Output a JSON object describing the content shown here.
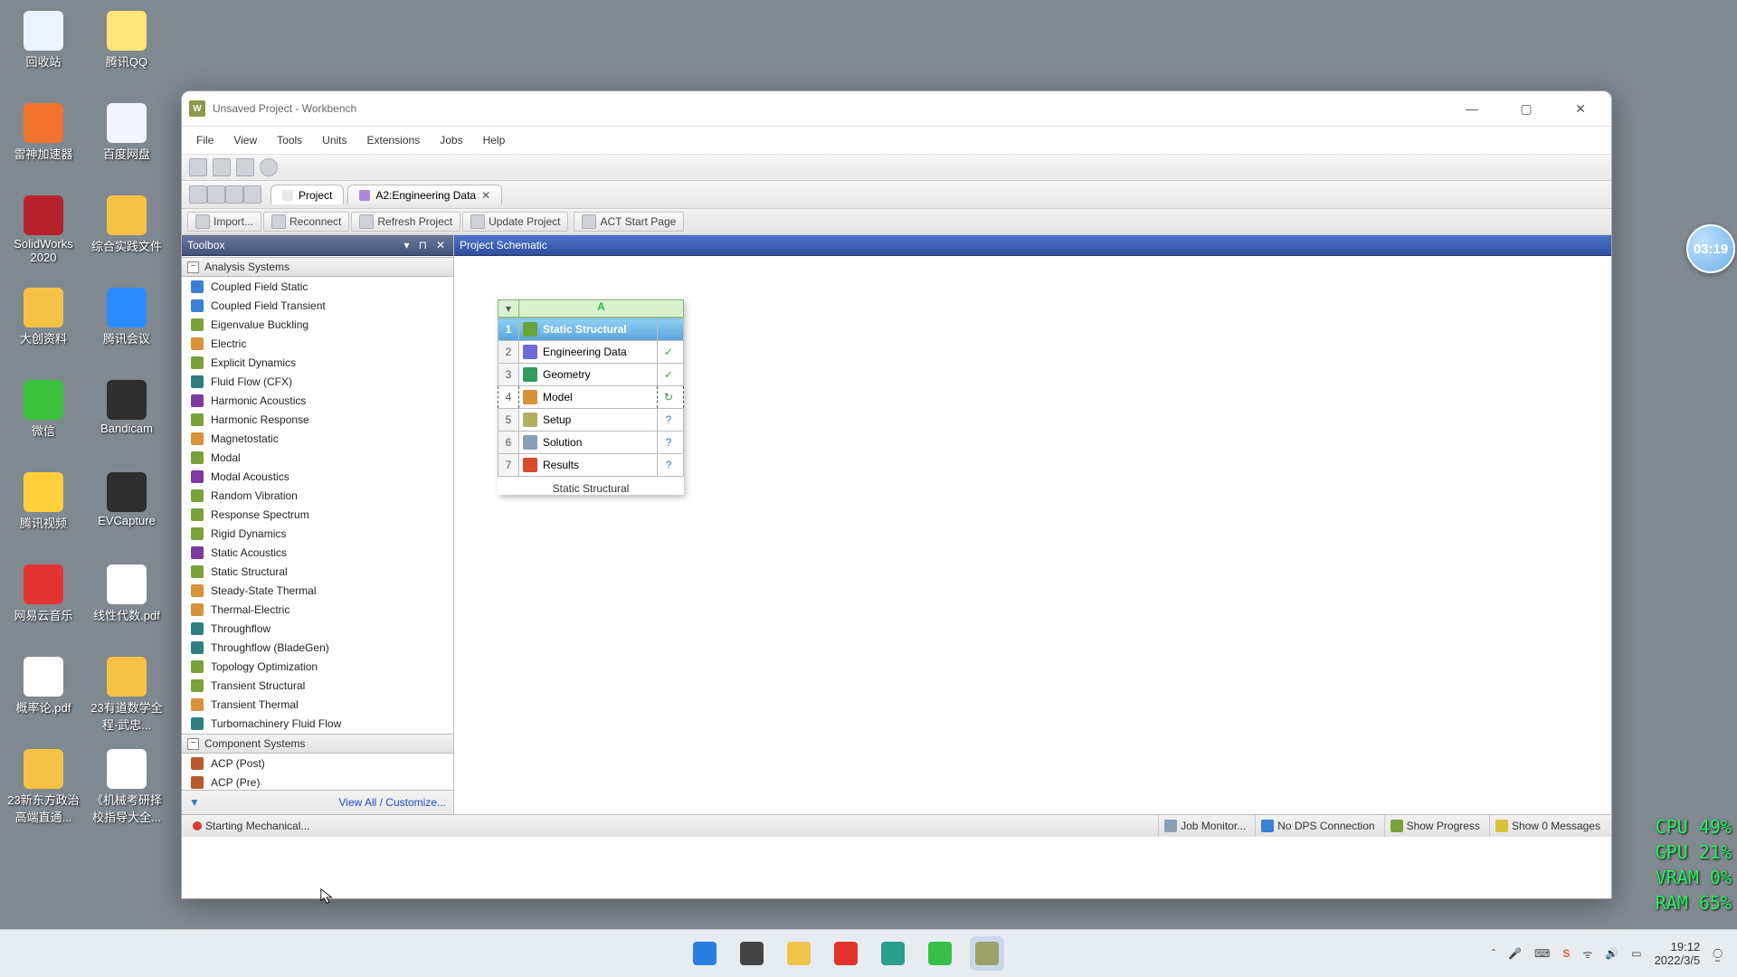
{
  "desktop_icons": [
    {
      "label": "回收站",
      "bg": "#eaf3ff"
    },
    {
      "label": "腾讯QQ",
      "bg": "#ffe478"
    },
    {
      "label": "雷神加速器",
      "bg": "#f0742e"
    },
    {
      "label": "百度网盘",
      "bg": "#f2f5ff"
    },
    {
      "label": "SolidWorks 2020",
      "bg": "#b7222a"
    },
    {
      "label": "综合实践文件",
      "bg": "#f6c245"
    },
    {
      "label": "大创资料",
      "bg": "#f6c245"
    },
    {
      "label": "腾讯会议",
      "bg": "#2b8cff"
    },
    {
      "label": "微信",
      "bg": "#3cc33c"
    },
    {
      "label": "Bandicam",
      "bg": "#2e2e2e"
    },
    {
      "label": "腾讯视频",
      "bg": "#ffcf3e"
    },
    {
      "label": "EVCapture",
      "bg": "#2e2e2e"
    },
    {
      "label": "网易云音乐",
      "bg": "#e23434"
    },
    {
      "label": "线性代数.pdf",
      "bg": "#ffffff"
    },
    {
      "label": "概率论.pdf",
      "bg": "#ffffff"
    },
    {
      "label": "23有道数学全程·武忠...",
      "bg": "#f6c245"
    },
    {
      "label": "23新东方政治高端直通...",
      "bg": "#f6c245"
    },
    {
      "label": "《机械考研择校指导大全...",
      "bg": "#ffffff"
    }
  ],
  "window_title": "Unsaved Project - Workbench",
  "menus": [
    "File",
    "View",
    "Tools",
    "Units",
    "Extensions",
    "Jobs",
    "Help"
  ],
  "tabs": [
    {
      "label": "Project",
      "active": true
    },
    {
      "label": "A2:Engineering Data",
      "active": false,
      "closable": true
    }
  ],
  "toolbar3": [
    "Import...",
    "Reconnect",
    "Refresh Project",
    "Update Project",
    "ACT Start Page"
  ],
  "toolbox_title": "Toolbox",
  "toolbox_groups": [
    {
      "name": "Analysis Systems",
      "items": [
        {
          "name": "Coupled Field Static",
          "c": "#3a7fd8"
        },
        {
          "name": "Coupled Field Transient",
          "c": "#3a7fd8"
        },
        {
          "name": "Eigenvalue Buckling",
          "c": "#7aa23a"
        },
        {
          "name": "Electric",
          "c": "#d8923a"
        },
        {
          "name": "Explicit Dynamics",
          "c": "#7aa23a"
        },
        {
          "name": "Fluid Flow (CFX)",
          "c": "#2f7f7f"
        },
        {
          "name": "Harmonic Acoustics",
          "c": "#7c3aa2"
        },
        {
          "name": "Harmonic Response",
          "c": "#7aa23a"
        },
        {
          "name": "Magnetostatic",
          "c": "#d8923a"
        },
        {
          "name": "Modal",
          "c": "#7aa23a"
        },
        {
          "name": "Modal Acoustics",
          "c": "#7c3aa2"
        },
        {
          "name": "Random Vibration",
          "c": "#7aa23a"
        },
        {
          "name": "Response Spectrum",
          "c": "#7aa23a"
        },
        {
          "name": "Rigid Dynamics",
          "c": "#7aa23a"
        },
        {
          "name": "Static Acoustics",
          "c": "#7c3aa2"
        },
        {
          "name": "Static Structural",
          "c": "#7aa23a"
        },
        {
          "name": "Steady-State Thermal",
          "c": "#d8923a"
        },
        {
          "name": "Thermal-Electric",
          "c": "#d8923a"
        },
        {
          "name": "Throughflow",
          "c": "#2f7f7f"
        },
        {
          "name": "Throughflow (BladeGen)",
          "c": "#2f7f7f"
        },
        {
          "name": "Topology Optimization",
          "c": "#7aa23a"
        },
        {
          "name": "Transient Structural",
          "c": "#7aa23a"
        },
        {
          "name": "Transient Thermal",
          "c": "#d8923a"
        },
        {
          "name": "Turbomachinery Fluid Flow",
          "c": "#2f7f7f"
        }
      ]
    },
    {
      "name": "Component Systems",
      "items": [
        {
          "name": "ACP (Post)",
          "c": "#b85a2e"
        },
        {
          "name": "ACP (Pre)",
          "c": "#b85a2e"
        }
      ]
    }
  ],
  "toolbox_footer": "View All / Customize...",
  "schematic_title": "Project Schematic",
  "system": {
    "col": "A",
    "name": "Static Structural",
    "rows": [
      {
        "idx": 1,
        "label": "Static Structural",
        "ico": "#6aa23a",
        "stat": "",
        "hdr": true
      },
      {
        "idx": 2,
        "label": "Engineering Data",
        "ico": "#6a6ad8",
        "stat": "✓"
      },
      {
        "idx": 3,
        "label": "Geometry",
        "ico": "#2e9e5a",
        "stat": "✓"
      },
      {
        "idx": 4,
        "label": "Model",
        "ico": "#d8923a",
        "stat": "↻",
        "sel": true
      },
      {
        "idx": 5,
        "label": "Setup",
        "ico": "#b0b060",
        "stat": "?"
      },
      {
        "idx": 6,
        "label": "Solution",
        "ico": "#8aa0b8",
        "stat": "?"
      },
      {
        "idx": 7,
        "label": "Results",
        "ico": "#d84a2e",
        "stat": "?"
      }
    ]
  },
  "timer": "03:19",
  "hw": [
    "CPU  49%",
    "GPU  21%",
    "VRAM  0%",
    "RAM  65%"
  ],
  "status_left": "Starting Mechanical...",
  "status_right": [
    "Job Monitor...",
    "No DPS Connection",
    "Show Progress",
    "Show 0 Messages"
  ],
  "taskbar_center": [
    {
      "bg": "#2a7de1"
    },
    {
      "bg": "#444"
    },
    {
      "bg": "#f0c44a"
    },
    {
      "bg": "#e2332e"
    },
    {
      "bg": "#2c9e8e"
    },
    {
      "bg": "#36c04a"
    },
    {
      "bg": "#9aa26a",
      "active": true
    }
  ],
  "clock": {
    "time": "19:12",
    "date": "2022/3/5"
  }
}
